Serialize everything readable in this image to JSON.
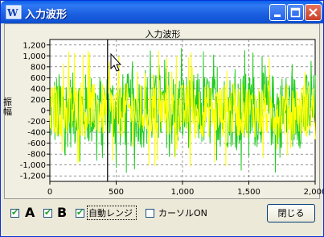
{
  "window": {
    "title": "入力波形",
    "icon": "app-icon"
  },
  "titlebar_buttons": {
    "minimize": "minimize-icon",
    "maximize": "maximize-icon",
    "close": "close-icon"
  },
  "chart_data": {
    "type": "line",
    "title": "入力波形",
    "ylabel": "振幅",
    "xlabel": "",
    "xlim": [
      0,
      2000
    ],
    "ylim": [
      -1300,
      1300
    ],
    "x_ticks": [
      "0",
      "500",
      "1,000",
      "1,500",
      "2,000"
    ],
    "x_tick_values": [
      0,
      500,
      1000,
      1500,
      2000
    ],
    "y_ticks": [
      "1,200",
      "1,000",
      "800",
      "600",
      "400",
      "200",
      "0",
      "-200",
      "-400",
      "-600",
      "-800",
      "-1,000",
      "-1,200"
    ],
    "y_tick_values": [
      1200,
      1000,
      800,
      600,
      400,
      200,
      0,
      -200,
      -400,
      -600,
      -800,
      -1000,
      -1200
    ],
    "grid": true,
    "cursor_x": 435,
    "series": [
      {
        "color": "#22cc22",
        "amplitude_typical": 700,
        "amplitude_max": 1150
      },
      {
        "color": "#ffff00",
        "amplitude_typical": 500,
        "amplitude_max": 1100
      }
    ]
  },
  "controls": {
    "checkbox_a": {
      "label": "A",
      "checked": true
    },
    "checkbox_b": {
      "label": "B",
      "checked": true
    },
    "auto_range": {
      "label": "自動レンジ",
      "checked": true
    },
    "cursor_on": {
      "label": "カーソルON",
      "checked": false
    },
    "close_button": "閉じる"
  },
  "colors": {
    "title_bar": "#1b5fe0",
    "series_a": "#22cc22",
    "series_b": "#ffff00",
    "checkmark": "#21a121"
  }
}
